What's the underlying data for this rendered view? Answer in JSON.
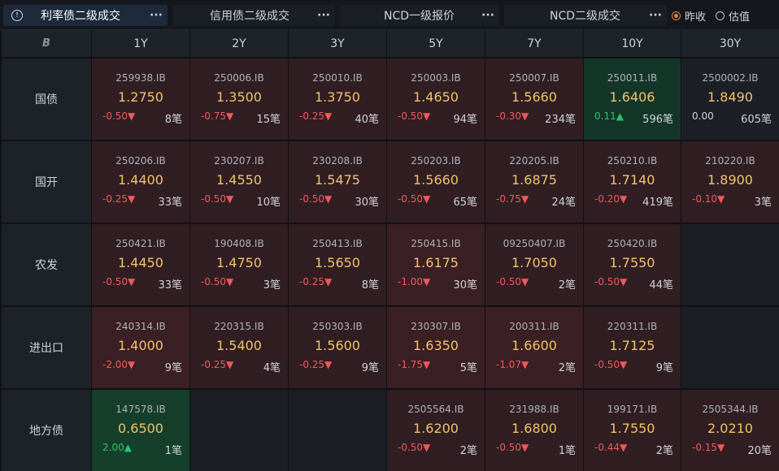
{
  "tabs": [
    {
      "label": "利率债二级成交",
      "active": true
    },
    {
      "label": "信用债二级成交",
      "active": false
    },
    {
      "label": "NCD一级报价",
      "active": false
    },
    {
      "label": "NCD二级成交",
      "active": false
    }
  ],
  "more_glyph": "···",
  "info_glyph": "!",
  "radios": [
    {
      "label": "昨收",
      "checked": true
    },
    {
      "label": "估值",
      "checked": false
    }
  ],
  "corner_glyph": "B",
  "columns": [
    "1Y",
    "2Y",
    "3Y",
    "5Y",
    "7Y",
    "10Y",
    "30Y"
  ],
  "rows": [
    {
      "label": "国债",
      "cells": [
        {
          "code": "259938.IB",
          "price": "1.2750",
          "chg": "-0.50▼",
          "dir": "down",
          "count": "8笔",
          "tone": "lred"
        },
        {
          "code": "250006.IB",
          "price": "1.3500",
          "chg": "-0.75▼",
          "dir": "down",
          "count": "15笔",
          "tone": "lred"
        },
        {
          "code": "250010.IB",
          "price": "1.3750",
          "chg": "-0.25▼",
          "dir": "down",
          "count": "40笔",
          "tone": "lred"
        },
        {
          "code": "250003.IB",
          "price": "1.4650",
          "chg": "-0.50▼",
          "dir": "down",
          "count": "94笔",
          "tone": "lred"
        },
        {
          "code": "250007.IB",
          "price": "1.5660",
          "chg": "-0.30▼",
          "dir": "down",
          "count": "234笔",
          "tone": "lred"
        },
        {
          "code": "250011.IB",
          "price": "1.6406",
          "chg": "0.11▲",
          "dir": "up",
          "count": "596笔",
          "tone": "green"
        },
        {
          "code": "2500002.IB",
          "price": "1.8490",
          "chg": "0.00",
          "dir": "flat",
          "count": "605笔",
          "tone": "neutral"
        }
      ]
    },
    {
      "label": "国开",
      "cells": [
        {
          "code": "250206.IB",
          "price": "1.4400",
          "chg": "-0.25▼",
          "dir": "down",
          "count": "33笔",
          "tone": "lred"
        },
        {
          "code": "230207.IB",
          "price": "1.4550",
          "chg": "-0.50▼",
          "dir": "down",
          "count": "10笔",
          "tone": "lred"
        },
        {
          "code": "230208.IB",
          "price": "1.5475",
          "chg": "-0.50▼",
          "dir": "down",
          "count": "30笔",
          "tone": "lred"
        },
        {
          "code": "250203.IB",
          "price": "1.5660",
          "chg": "-0.50▼",
          "dir": "down",
          "count": "65笔",
          "tone": "lred"
        },
        {
          "code": "220205.IB",
          "price": "1.6875",
          "chg": "-0.75▼",
          "dir": "down",
          "count": "24笔",
          "tone": "lred"
        },
        {
          "code": "250210.IB",
          "price": "1.7140",
          "chg": "-0.20▼",
          "dir": "down",
          "count": "419笔",
          "tone": "lred"
        },
        {
          "code": "210220.IB",
          "price": "1.8900",
          "chg": "-0.10▼",
          "dir": "down",
          "count": "3笔",
          "tone": "lred"
        }
      ]
    },
    {
      "label": "农发",
      "cells": [
        {
          "code": "250421.IB",
          "price": "1.4450",
          "chg": "-0.50▼",
          "dir": "down",
          "count": "33笔",
          "tone": "lred"
        },
        {
          "code": "190408.IB",
          "price": "1.4750",
          "chg": "-0.50▼",
          "dir": "down",
          "count": "3笔",
          "tone": "lred"
        },
        {
          "code": "250413.IB",
          "price": "1.5650",
          "chg": "-0.25▼",
          "dir": "down",
          "count": "8笔",
          "tone": "lred"
        },
        {
          "code": "250415.IB",
          "price": "1.6175",
          "chg": "-1.00▼",
          "dir": "down",
          "count": "30笔",
          "tone": "dred"
        },
        {
          "code": "09250407.IB",
          "price": "1.7050",
          "chg": "-0.50▼",
          "dir": "down",
          "count": "2笔",
          "tone": "lred"
        },
        {
          "code": "250420.IB",
          "price": "1.7550",
          "chg": "-0.50▼",
          "dir": "down",
          "count": "44笔",
          "tone": "lred"
        },
        null
      ]
    },
    {
      "label": "进出口",
      "cells": [
        {
          "code": "240314.IB",
          "price": "1.4000",
          "chg": "-2.00▼",
          "dir": "down",
          "count": "9笔",
          "tone": "dred"
        },
        {
          "code": "220315.IB",
          "price": "1.5400",
          "chg": "-0.25▼",
          "dir": "down",
          "count": "4笔",
          "tone": "lred"
        },
        {
          "code": "250303.IB",
          "price": "1.5600",
          "chg": "-0.25▼",
          "dir": "down",
          "count": "9笔",
          "tone": "lred"
        },
        {
          "code": "230307.IB",
          "price": "1.6350",
          "chg": "-1.75▼",
          "dir": "down",
          "count": "5笔",
          "tone": "dred"
        },
        {
          "code": "200311.IB",
          "price": "1.6600",
          "chg": "-1.07▼",
          "dir": "down",
          "count": "2笔",
          "tone": "dred"
        },
        {
          "code": "220311.IB",
          "price": "1.7125",
          "chg": "-0.50▼",
          "dir": "down",
          "count": "9笔",
          "tone": "lred"
        },
        null
      ]
    },
    {
      "label": "地方债",
      "cells": [
        {
          "code": "147578.IB",
          "price": "0.6500",
          "chg": "2.00▲",
          "dir": "up",
          "count": "1笔",
          "tone": "greenbright"
        },
        null,
        null,
        {
          "code": "2505564.IB",
          "price": "1.6200",
          "chg": "-0.50▼",
          "dir": "down",
          "count": "2笔",
          "tone": "lred"
        },
        {
          "code": "231988.IB",
          "price": "1.6800",
          "chg": "-0.50▼",
          "dir": "down",
          "count": "1笔",
          "tone": "lred"
        },
        {
          "code": "199171.IB",
          "price": "1.7550",
          "chg": "-0.44▼",
          "dir": "down",
          "count": "2笔",
          "tone": "lred"
        },
        {
          "code": "2505344.IB",
          "price": "2.0210",
          "chg": "-0.15▼",
          "dir": "down",
          "count": "20笔",
          "tone": "lred"
        }
      ]
    }
  ]
}
